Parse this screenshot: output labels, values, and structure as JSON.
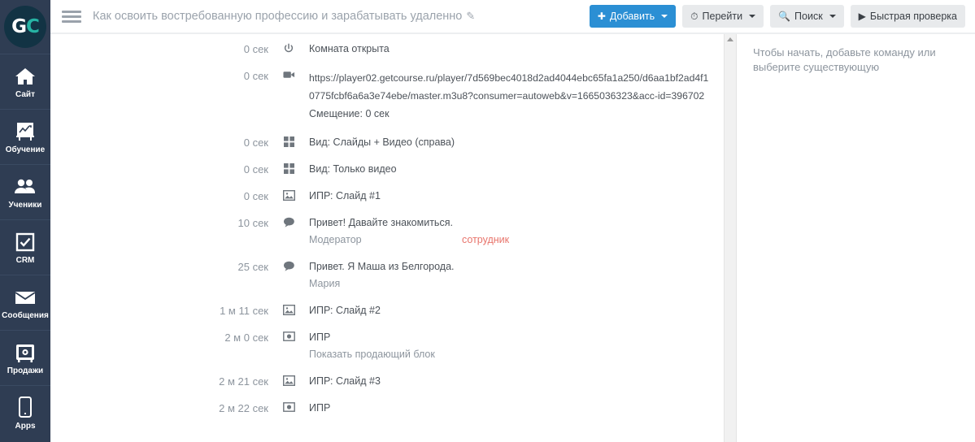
{
  "brand": {
    "logo_g": "G",
    "logo_c": "C",
    "circle_color": "#123344",
    "accent_color": "#27b3a4"
  },
  "sidebar": {
    "background": "#2f3d53",
    "items": [
      {
        "label": "Сайт",
        "icon": "home-icon"
      },
      {
        "label": "Обучение",
        "icon": "easel-chart-icon"
      },
      {
        "label": "Ученики",
        "icon": "people-icon"
      },
      {
        "label": "CRM",
        "icon": "checkbox-icon"
      },
      {
        "label": "Сообщения",
        "icon": "envelope-icon"
      },
      {
        "label": "Продажи",
        "icon": "safe-icon"
      },
      {
        "label": "Apps",
        "icon": "phone-icon"
      }
    ]
  },
  "header": {
    "menu_icon": "hamburger-icon",
    "title": "Как освоить востребованную профессию и зарабатывать удаленно",
    "edit_icon": "pencil-icon",
    "buttons": [
      {
        "label": "Добавить",
        "icon": "plus-icon",
        "caret": true,
        "primary": true,
        "accent": "#2b8fd4"
      },
      {
        "label": "Перейти",
        "icon": "clock-icon",
        "caret": true,
        "primary": false
      },
      {
        "label": "Поиск",
        "icon": "search-icon",
        "caret": true,
        "primary": false
      },
      {
        "label": "Быстрая проверка",
        "icon": "play-icon",
        "caret": false,
        "primary": false
      }
    ]
  },
  "timeline": {
    "rows": [
      {
        "time": "0 сек",
        "icon": "power-icon",
        "title": "Комната открыта"
      },
      {
        "time": "0 сек",
        "icon": "video-camera-icon",
        "url_line1": "https://player02.getcourse.ru/player/7d569bec4018d2ad4044ebc65fa1a250/d6aa1bf2ad4f1",
        "url_line2": "0775fcbf6a6a3e74ebe/master.m3u8?consumer=autoweb&v=1665036323&acc-id=396702",
        "offset": "Смещение: 0 сек"
      },
      {
        "time": "0 сек",
        "icon": "grid-icon",
        "title": "Вид: Слайды + Видео (справа)"
      },
      {
        "time": "0 сек",
        "icon": "grid-icon",
        "title": "Вид: Только видео"
      },
      {
        "time": "0 сек",
        "icon": "image-icon",
        "title": "ИПР: Слайд #1"
      },
      {
        "time": "10 сек",
        "icon": "chat-bubble-icon",
        "title": "Привет! Давайте знакомиться.",
        "author": "Модератор",
        "tag": "сотрудник"
      },
      {
        "time": "25 сек",
        "icon": "chat-bubble-icon",
        "title": "Привет. Я Маша из Белгорода.",
        "author": "Мария"
      },
      {
        "time": "1 м 11 сек",
        "icon": "image-icon",
        "title": "ИПР: Слайд #2"
      },
      {
        "time": "2 м 0 сек",
        "icon": "money-icon",
        "title": "ИПР",
        "note": "Показать продающий блок"
      },
      {
        "time": "2 м 21 сек",
        "icon": "image-icon",
        "title": "ИПР: Слайд #3"
      },
      {
        "time": "2 м 22 сек",
        "icon": "money-icon",
        "title": "ИПР"
      }
    ]
  },
  "side_panel": {
    "hint": "Чтобы начать, добавьте команду или выберите существующую"
  },
  "scrollbar": {
    "arrow_icon": "scroll-up-arrow-icon"
  }
}
